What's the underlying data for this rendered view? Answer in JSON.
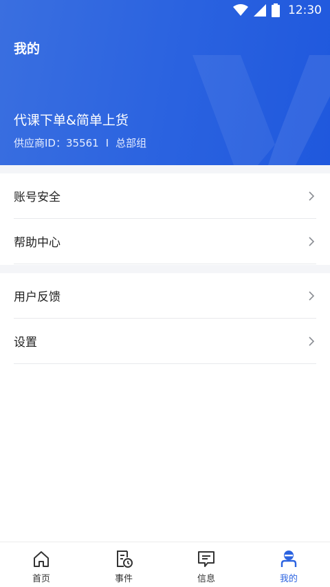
{
  "status_bar": {
    "time": "12:30"
  },
  "header": {
    "title": "我的",
    "shop_name": "代课下单&简单上货",
    "supplier_prefix": "供应商ID：",
    "supplier_id": "35561",
    "separator": "I",
    "org": "总部组"
  },
  "menu": {
    "group1": [
      {
        "label": "账号安全"
      },
      {
        "label": "帮助中心"
      }
    ],
    "group2": [
      {
        "label": "用户反馈"
      },
      {
        "label": "设置"
      }
    ]
  },
  "bottom_nav": {
    "items": [
      {
        "label": "首页",
        "icon": "home-icon"
      },
      {
        "label": "事件",
        "icon": "event-icon"
      },
      {
        "label": "信息",
        "icon": "message-icon"
      },
      {
        "label": "我的",
        "icon": "profile-icon",
        "active": true
      }
    ]
  },
  "colors": {
    "accent": "#2b63e0",
    "header_gradient_start": "#3a6fe0",
    "header_gradient_end": "#1f58dd",
    "divider": "#e8e9ec",
    "background_gap": "#f4f5f8"
  }
}
